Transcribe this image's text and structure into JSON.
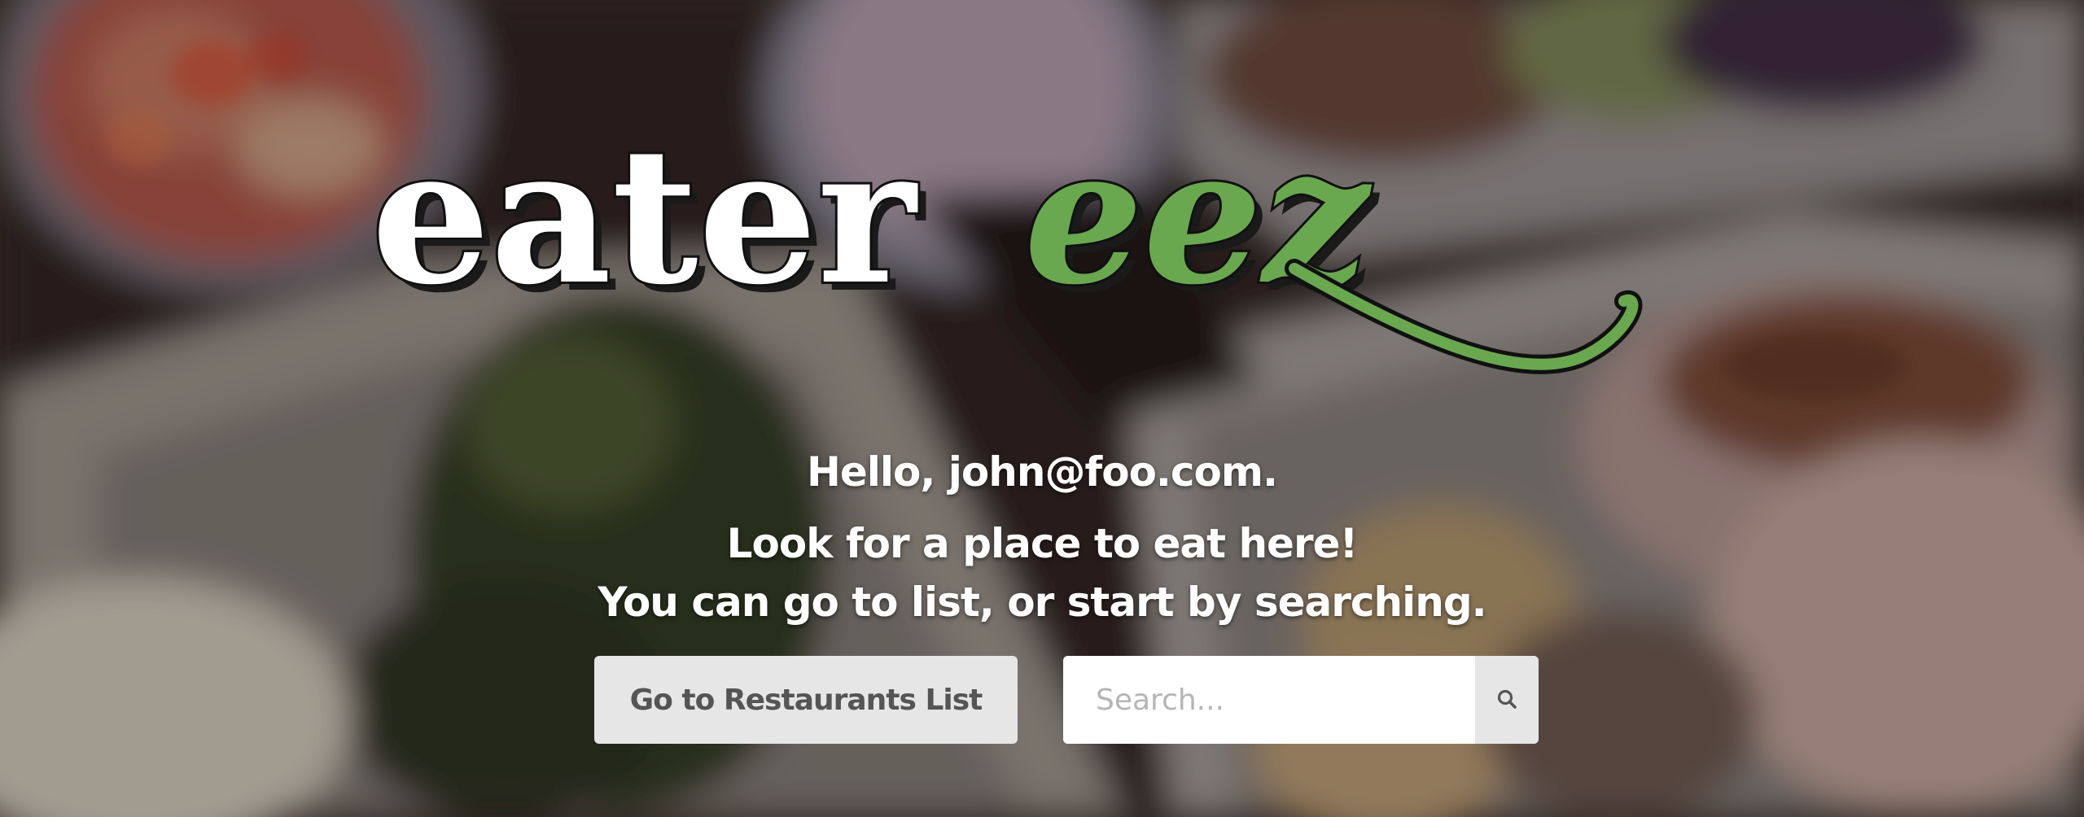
{
  "brand": {
    "logo_part1": "eater",
    "logo_part2": "eez",
    "accent_color": "#6aa84f"
  },
  "greeting": "Hello, john@foo.com.",
  "tagline": {
    "line1": "Look for a place to eat here!",
    "line2": "You can go to list, or start by searching."
  },
  "actions": {
    "list_button_label": "Go to Restaurants List",
    "search_placeholder": "Search...",
    "search_icon": "magnifying-glass"
  }
}
